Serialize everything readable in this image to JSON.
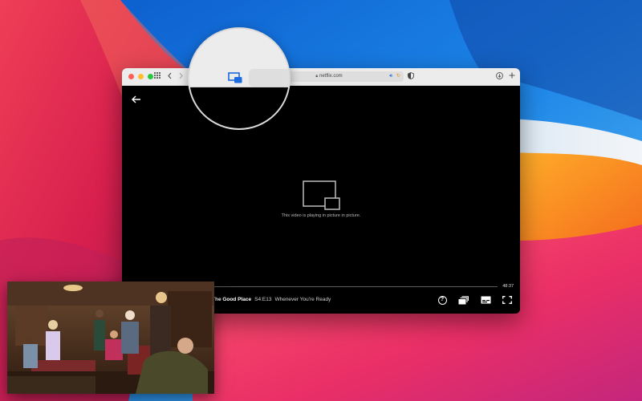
{
  "browser": {
    "url": "netflix.com",
    "icons": [
      "sidebar-grid-icon",
      "back-icon",
      "forward-icon",
      "lock-icon",
      "speaker-icon",
      "reload-icon",
      "shield-icon",
      "download-icon",
      "new-tab-icon",
      "picture-in-picture-icon"
    ]
  },
  "player": {
    "pip_message": "This video is playing in picture in picture.",
    "time_remaining": "48:37",
    "show_title": "The Good Place",
    "episode_code": "S4:E13",
    "episode_title": "Whenever You're Ready",
    "progress_fraction": 0.0,
    "controls": [
      "help-icon",
      "episodes-icon",
      "subtitles-icon",
      "fullscreen-icon"
    ]
  },
  "colors": {
    "accent_blue": "#1e6be0",
    "player_background": "#000000",
    "titlebar": "#ececec"
  }
}
